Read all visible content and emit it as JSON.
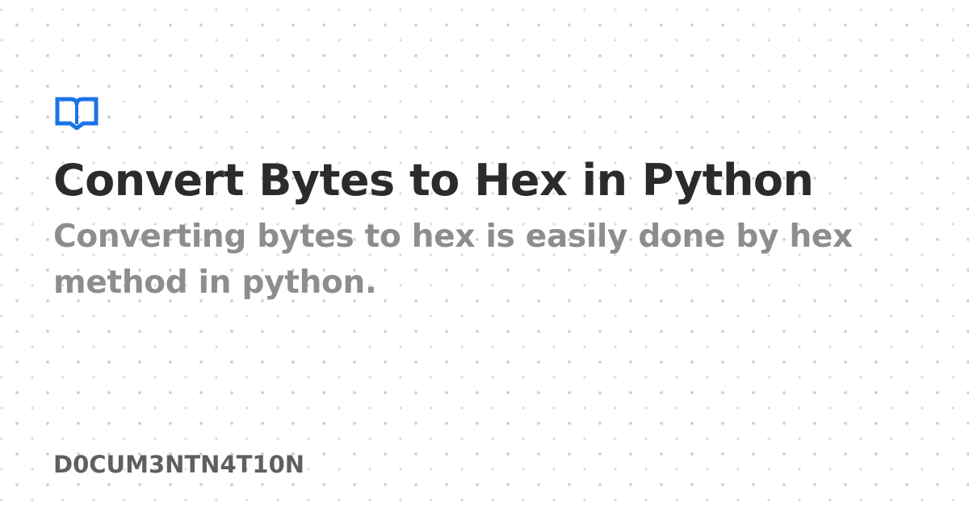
{
  "card": {
    "icon": "book-icon",
    "accent_color": "#1a73e8",
    "title": "Convert Bytes to Hex in Python",
    "subtitle": "Converting bytes to hex is easily done by hex method in python.",
    "brand": "D0CUM3NTN4T10N"
  }
}
